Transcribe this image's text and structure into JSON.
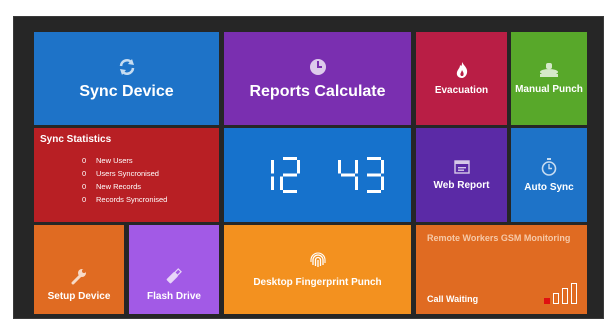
{
  "tiles": {
    "sync_device": {
      "label": "Sync Device",
      "icon": "sync-icon"
    },
    "reports_calculate": {
      "label": "Reports Calculate",
      "icon": "clock-icon"
    },
    "evacuation": {
      "label": "Evacuation",
      "icon": "fire-icon"
    },
    "manual_punch": {
      "label": "Manual Punch",
      "icon": "stamp-icon"
    },
    "web_report": {
      "label": "Web Report",
      "icon": "browser-icon"
    },
    "auto_sync": {
      "label": "Auto Sync",
      "icon": "stopwatch-icon"
    },
    "setup_device": {
      "label": "Setup Device",
      "icon": "wrench-icon"
    },
    "flash_drive": {
      "label": "Flash Drive",
      "icon": "usb-icon"
    },
    "desktop_fingerprint": {
      "label": "Desktop Fingerprint Punch",
      "icon": "fingerprint-icon"
    },
    "gsm": {
      "title": "Remote Workers GSM Monitoring",
      "status": "Call Waiting",
      "signal_level": 1,
      "signal_max": 4
    }
  },
  "stats": {
    "title": "Sync Statistics",
    "rows": [
      {
        "value": "0",
        "label": "New Users"
      },
      {
        "value": "0",
        "label": "Users Syncronised"
      },
      {
        "value": "0",
        "label": "New Records"
      },
      {
        "value": "0",
        "label": "Records Syncronised"
      }
    ]
  },
  "clock": {
    "hours": "12",
    "minutes": "43"
  },
  "colors": {
    "frame": "#262626",
    "blue": "#1e73c8",
    "purple": "#7a2fb0",
    "crimson": "#b91e45",
    "green": "#58a82a",
    "red": "#b81f24",
    "orange": "#e06b22",
    "violet": "#a25ae6",
    "amber": "#f3911f"
  }
}
